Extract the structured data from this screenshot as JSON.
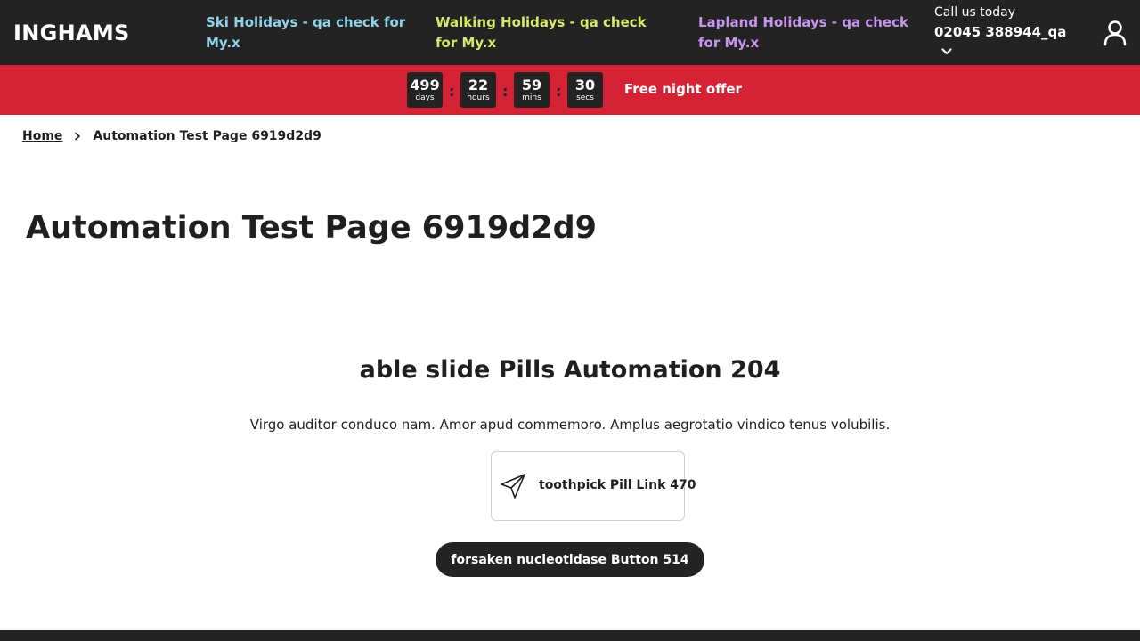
{
  "header": {
    "logo": "INGHAMS",
    "nav": [
      {
        "label": "Ski Holidays - qa check for My.x",
        "color": "#8fd3e8"
      },
      {
        "label": "Walking Holidays - qa check for My.x",
        "color": "#d8e86a"
      },
      {
        "label": "Lapland Holidays - qa check for My.x",
        "color": "#c795f0"
      }
    ],
    "call_label": "Call us today",
    "call_number": "02045 388944_qa",
    "icons": {
      "chevron": "chevron-down-icon",
      "account": "user-icon"
    }
  },
  "promo": {
    "countdown": [
      {
        "value": "499",
        "unit": "days"
      },
      {
        "value": "22",
        "unit": "hours"
      },
      {
        "value": "59",
        "unit": "mins"
      },
      {
        "value": "30",
        "unit": "secs"
      }
    ],
    "separator": ":",
    "offer": "Free night offer",
    "bg_color": "#d52234"
  },
  "breadcrumb": {
    "home": "Home",
    "current": "Automation Test Page 6919d2d9"
  },
  "page": {
    "title": "Automation Test Page 6919d2d9",
    "block_title": "able slide Pills Automation 204",
    "block_description": "Virgo auditor conduco nam. Amor apud commemoro. Amplus aegrotatio vindico tenus volubilis.",
    "pill_label": "toothpick Pill Link 470",
    "pill_icon": "paper-plane-icon",
    "button_label": "forsaken nucleotidase Button 514"
  }
}
